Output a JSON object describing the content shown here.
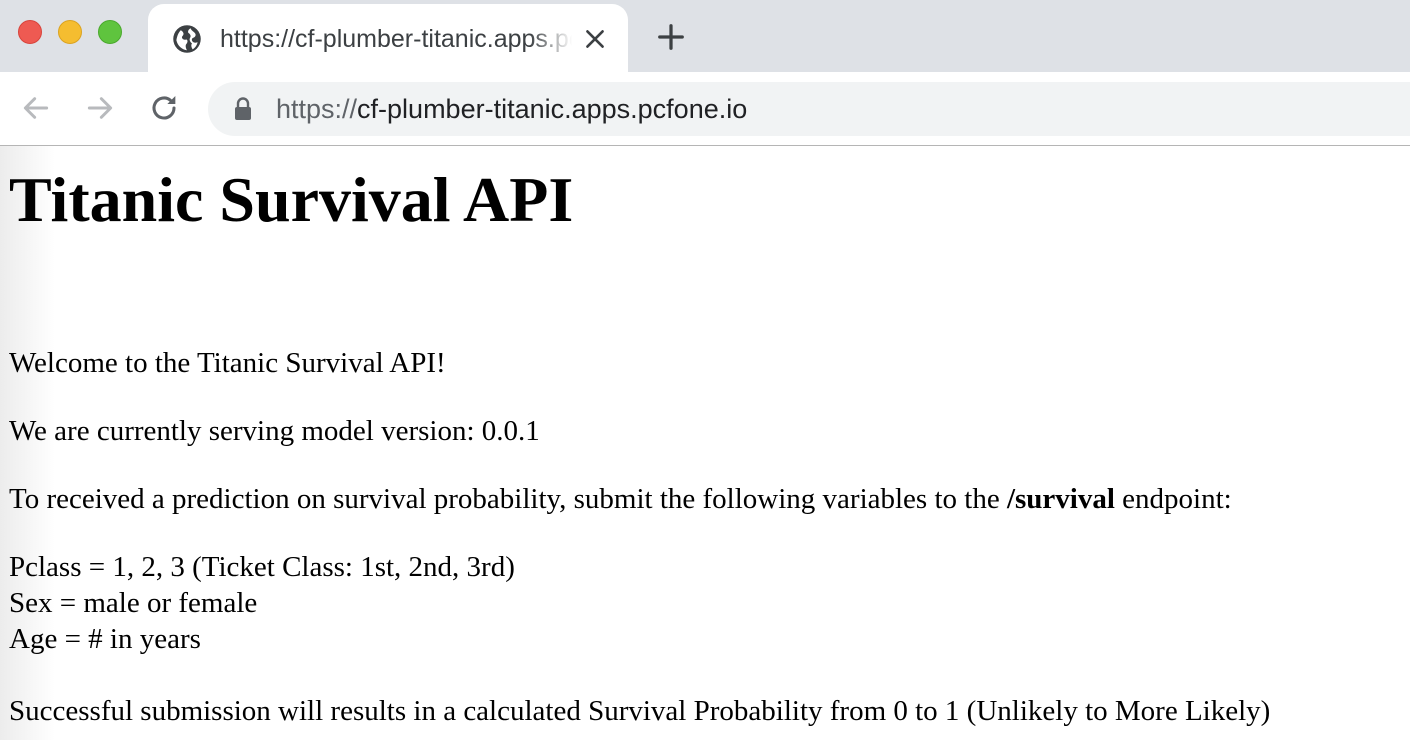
{
  "browser": {
    "tab": {
      "title": "https://cf-plumber-titanic.apps.pcfone.io",
      "favicon_icon": "globe-icon",
      "close_icon": "close-icon"
    },
    "new_tab_icon": "plus-icon",
    "nav": {
      "back_icon": "arrow-left-icon",
      "forward_icon": "arrow-right-icon",
      "reload_icon": "reload-icon"
    },
    "address_bar": {
      "lock_icon": "lock-icon",
      "scheme": "https://",
      "host": "cf-plumber-titanic.apps.pcfone.io"
    },
    "colors": {
      "traffic_red": "#ee5a52",
      "traffic_yellow": "#f5bd30",
      "traffic_green": "#5fc43e",
      "tabstrip_bg": "#dee1e6",
      "omnibox_bg": "#f1f3f4"
    }
  },
  "page": {
    "title": "Titanic Survival API",
    "welcome": "Welcome to the Titanic Survival API!",
    "version_line": "We are currently serving model version: 0.0.1",
    "instructions": {
      "before": "To received a prediction on survival probability, submit the following variables to the ",
      "endpoint": "/survival",
      "after": " endpoint:"
    },
    "variables": [
      "Pclass = 1, 2, 3 (Ticket Class: 1st, 2nd, 3rd)",
      "Sex = male or female",
      "Age = # in years"
    ],
    "result_note": "Successful submission will results in a calculated Survival Probability from 0 to 1 (Unlikely to More Likely)"
  }
}
